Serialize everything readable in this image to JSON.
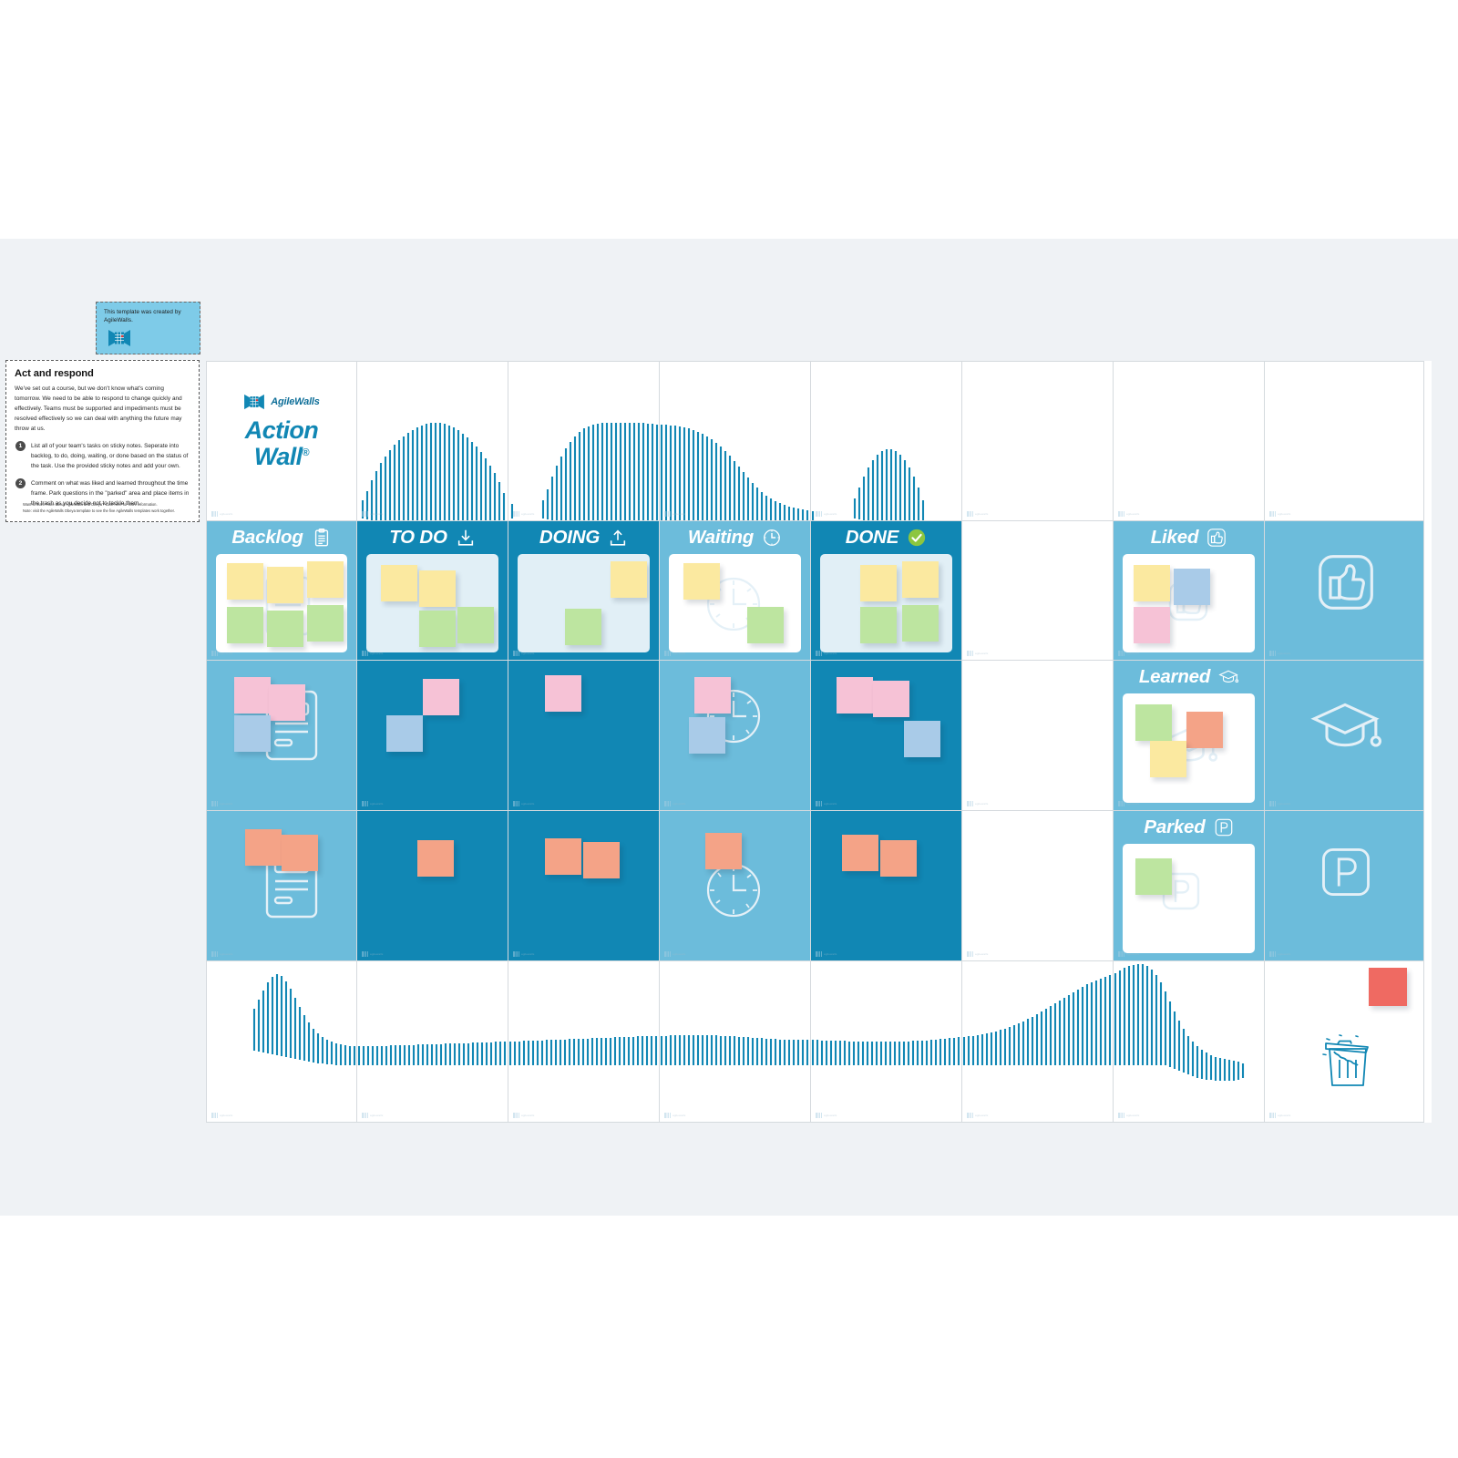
{
  "attribution_note": {
    "text": "This template was created by AgileWalls.",
    "logo_icon": "agilewalls-logo-icon",
    "bg_color": "#7ecbe8"
  },
  "instructions": {
    "title": "Act and respond",
    "lead": "We've set out a course, but we don't know what's coming tomorrow. We need to be able to respond to change quickly and effectively. Teams must be supported and impediments must be resolved effectively so we can deal with anything the future may throw at us.",
    "steps": [
      {
        "num": "1",
        "text": "List all of your team's tasks on sticky notes. Seperate into backlog, to do, doing, waiting, or done based on the status of the task. Use the provided sticky notes and add your own."
      },
      {
        "num": "2",
        "text": "Comment on what was liked and learned throughout the time frame. Park questions in the \"parked\" area and place items in the trash as you decide not to tackle them."
      }
    ],
    "fine_print_line1": "Want to learn more about AgileWalls and Obeya? Click here for more information.",
    "fine_print_line2": "Note: visit the AgileWalls Obeya template to see the five AgileWalls templates work together."
  },
  "brand": {
    "logo_text": "AgileWalls",
    "title_line1": "Action",
    "title_line2": "Wall",
    "registered_mark": "®",
    "logo_icon": "agilewalls-logo-icon",
    "accent_color": "#1187b4"
  },
  "cell_watermark_label": "agilewalls",
  "colors": {
    "header_dark": "#1187b4",
    "header_light": "#6cbcdb",
    "card_white": "#ffffff",
    "card_blue": "#e1eff6",
    "grid_line": "#d5dade",
    "canvas": "#eff2f5",
    "done_check_green": "#8cc63f",
    "note_yellow": "#fbe9a0",
    "note_green": "#bde5a0",
    "note_pink": "#f6c2d6",
    "note_blue": "#a9cbe8",
    "note_orange": "#f4a387",
    "note_red": "#ef6a62"
  },
  "columns": [
    {
      "id": "backlog",
      "label": "Backlog",
      "icon": "clipboard-icon",
      "tone": "light",
      "card": "white"
    },
    {
      "id": "todo",
      "label": "TO DO",
      "icon": "download-icon",
      "tone": "dark",
      "card": "blue"
    },
    {
      "id": "doing",
      "label": "DOING",
      "icon": "upload-icon",
      "tone": "dark",
      "card": "blue"
    },
    {
      "id": "waiting",
      "label": "Waiting",
      "icon": "clock-icon",
      "tone": "light",
      "card": "white"
    },
    {
      "id": "done",
      "label": "DONE",
      "icon": "check-circle-icon",
      "tone": "dark",
      "card": "blue"
    }
  ],
  "side_sections": [
    {
      "id": "liked",
      "label": "Liked",
      "icon": "thumbs-up-icon",
      "tone": "light",
      "card": "white"
    },
    {
      "id": "learned",
      "label": "Learned",
      "icon": "graduation-cap-icon",
      "tone": "light",
      "card": "white"
    },
    {
      "id": "parked",
      "label": "Parked",
      "icon": "parking-p-icon",
      "tone": "light",
      "card": "white"
    }
  ],
  "trash": {
    "icon": "trash-can-icon",
    "note_color": "#ef6a62"
  },
  "notes": {
    "backlog_row1": [
      "yellow",
      "yellow",
      "yellow",
      "green",
      "green",
      "green"
    ],
    "backlog_row2": [
      "pink",
      "pink",
      "blue"
    ],
    "backlog_row3": [
      "orange",
      "orange"
    ],
    "todo_row1": [
      "yellow",
      "yellow",
      "green",
      "green"
    ],
    "todo_row2": [
      "pink",
      "blue"
    ],
    "todo_row3": [
      "orange"
    ],
    "doing_row1": [
      "yellow",
      "green"
    ],
    "doing_row2": [
      "pink"
    ],
    "doing_row3": [
      "orange",
      "orange"
    ],
    "waiting_row1": [
      "yellow",
      "green"
    ],
    "waiting_row2": [
      "pink",
      "blue"
    ],
    "waiting_row3": [
      "orange"
    ],
    "done_row1": [
      "yellow",
      "yellow",
      "green",
      "green"
    ],
    "done_row2": [
      "pink",
      "pink",
      "blue"
    ],
    "done_row3": [
      "orange",
      "orange"
    ],
    "liked": [
      "yellow",
      "blue",
      "pink"
    ],
    "learned": [
      "green",
      "orange",
      "yellow"
    ],
    "parked": [
      "green"
    ],
    "trash": [
      "red"
    ]
  }
}
